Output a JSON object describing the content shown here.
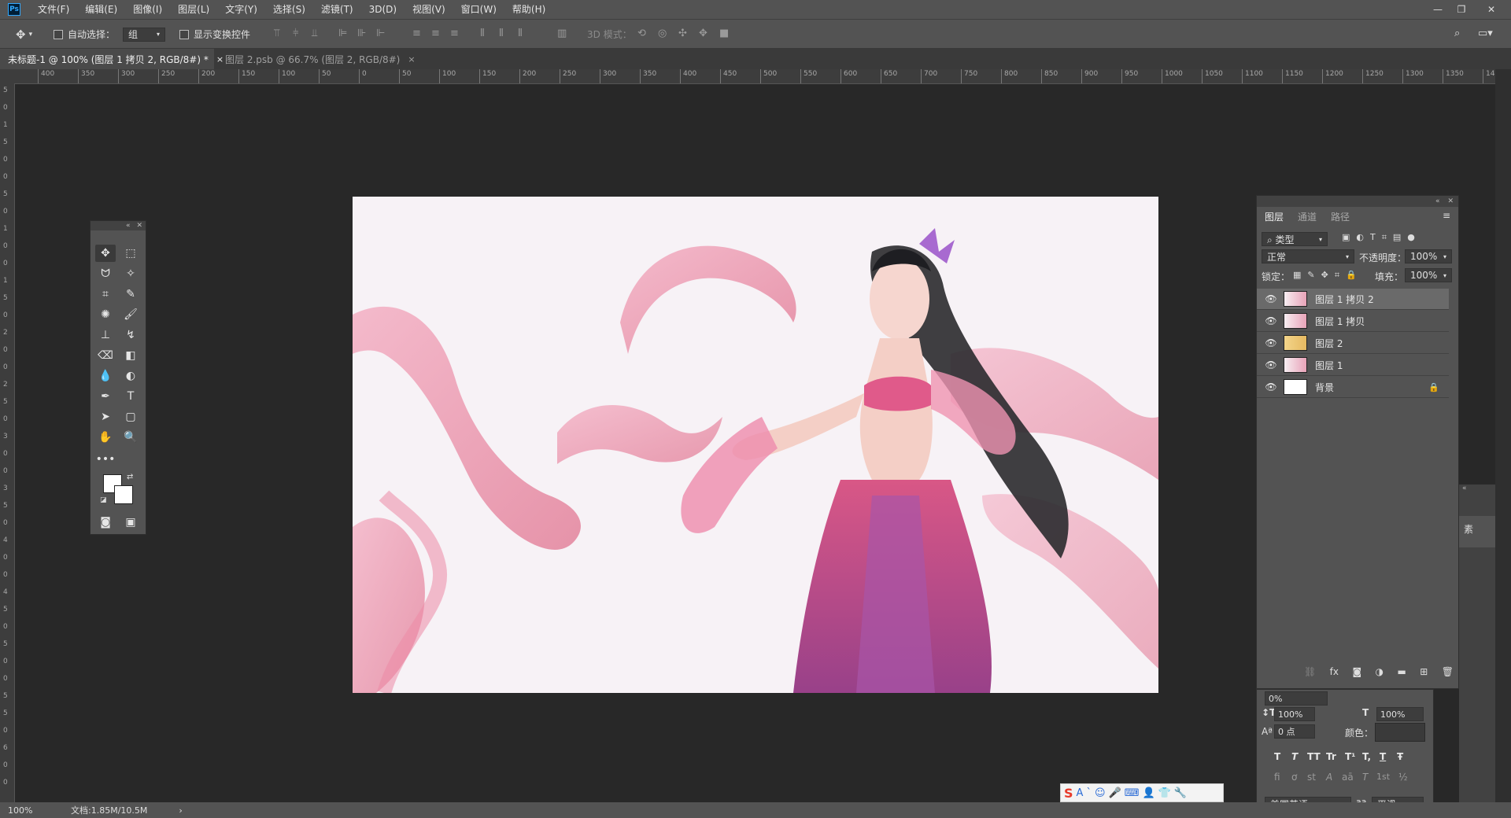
{
  "app": {
    "logo": "Ps"
  },
  "menu": [
    "文件(F)",
    "编辑(E)",
    "图像(I)",
    "图层(L)",
    "文字(Y)",
    "选择(S)",
    "滤镜(T)",
    "3D(D)",
    "视图(V)",
    "窗口(W)",
    "帮助(H)"
  ],
  "window_controls": {
    "minimize": "—",
    "restore": "❐",
    "close": "✕"
  },
  "options": {
    "auto_select_label": "自动选择：",
    "auto_select_value": "组",
    "show_transform_label": "显示变换控件",
    "mode_3d_label": "3D 模式："
  },
  "tabs": [
    {
      "label": "未标题-1 @ 100% (图层 1 拷贝 2, RGB/8#) *",
      "close": "×"
    },
    {
      "label": "图层 2.psb @ 66.7% (图层 2, RGB/8#)",
      "close": "×"
    }
  ],
  "ruler_h_ticks": [
    "400",
    "350",
    "300",
    "250",
    "200",
    "150",
    "100",
    "50",
    "0",
    "50",
    "100",
    "150",
    "200",
    "250",
    "300",
    "350",
    "400",
    "450",
    "500",
    "550",
    "600",
    "650",
    "700",
    "750",
    "800",
    "850",
    "900",
    "950",
    "1000",
    "1050",
    "1100",
    "1150",
    "1200",
    "1250",
    "1300",
    "1350",
    "1400"
  ],
  "ruler_v_ticks": [
    "5",
    "0",
    "1",
    "5",
    "0",
    "0",
    "5",
    "0",
    "1",
    "0",
    "0",
    "1",
    "5",
    "0",
    "2",
    "0",
    "0",
    "2",
    "5",
    "0",
    "3",
    "0",
    "0",
    "3",
    "5",
    "0",
    "4",
    "0",
    "0",
    "4",
    "5",
    "0",
    "5",
    "0",
    "0",
    "5",
    "5",
    "0",
    "6",
    "0",
    "0"
  ],
  "layers_panel": {
    "tabs": [
      "图层",
      "通道",
      "路径"
    ],
    "filter_kind": "类型",
    "blend_mode": "正常",
    "opacity_label": "不透明度：",
    "opacity_value": "100%",
    "lock_label": "锁定：",
    "fill_label": "填充：",
    "fill_value": "100%",
    "layers": [
      {
        "name": "图层 1 拷贝 2",
        "selected": true,
        "locked": false
      },
      {
        "name": "图层 1 拷贝",
        "selected": false,
        "locked": false
      },
      {
        "name": "图层 2",
        "selected": false,
        "locked": false
      },
      {
        "name": "图层 1",
        "selected": false,
        "locked": false
      },
      {
        "name": "背景",
        "selected": false,
        "locked": true
      }
    ],
    "footer_icons": [
      "link-icon",
      "fx-icon",
      "mask-icon",
      "adjustment-icon",
      "folder-icon",
      "new-layer-icon",
      "trash-icon"
    ],
    "fx_label": "fx"
  },
  "character_panel": {
    "tracking_value": "0%",
    "vscale_value": "100%",
    "hscale_value": "100%",
    "baseline_value": "0 点",
    "color_label": "颜色：",
    "language": "美国英语",
    "aa_label": "aa",
    "antialias": "平滑",
    "style_buttons": [
      "T",
      "T",
      "TT",
      "Tr",
      "T¹",
      "T,",
      "T",
      "Ŧ"
    ],
    "ot_buttons": [
      "fi",
      "ơ",
      "st",
      "A",
      "aā",
      "T",
      "1st",
      "½"
    ]
  },
  "right_dock": {
    "label": "素"
  },
  "status": {
    "zoom": "100%",
    "doc_info": "文档:1.85M/10.5M",
    "arrow": "›"
  },
  "ime": {
    "logo": "S",
    "icons": [
      "A",
      "ˋ",
      "☺",
      "🎤",
      "⌨",
      "👤",
      "👕",
      "🔧"
    ]
  }
}
